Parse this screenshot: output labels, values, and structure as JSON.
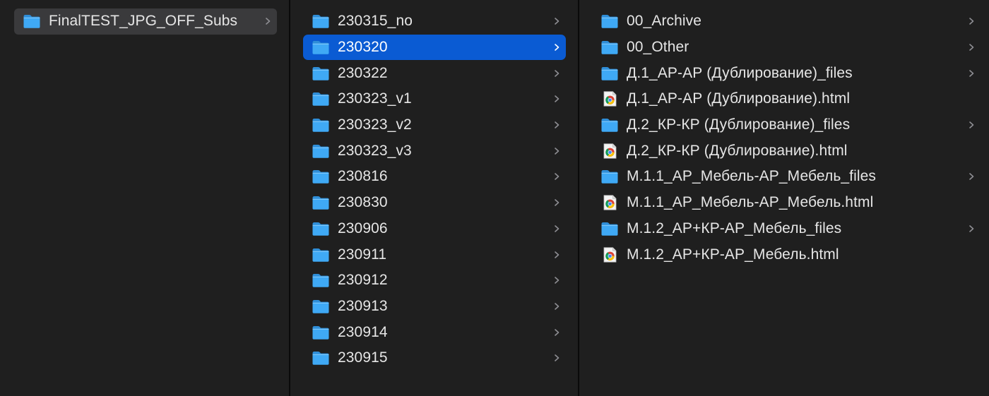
{
  "colors": {
    "background": "#1f1f1f",
    "divider": "#0a0a0a",
    "selected": "#0a5bd3",
    "parent_highlight": "#3a3a3c",
    "folder_blue": "#3fa9f5",
    "text": "#e6e6e6"
  },
  "columns": [
    {
      "items": [
        {
          "label": "FinalTEST_JPG_OFF_Subs",
          "kind": "folder",
          "state": "parent",
          "chevron": true
        }
      ]
    },
    {
      "items": [
        {
          "label": "230315_no",
          "kind": "folder",
          "state": "",
          "chevron": true
        },
        {
          "label": "230320",
          "kind": "folder",
          "state": "selected",
          "chevron": true
        },
        {
          "label": "230322",
          "kind": "folder",
          "state": "",
          "chevron": true
        },
        {
          "label": "230323_v1",
          "kind": "folder",
          "state": "",
          "chevron": true
        },
        {
          "label": "230323_v2",
          "kind": "folder",
          "state": "",
          "chevron": true
        },
        {
          "label": "230323_v3",
          "kind": "folder",
          "state": "",
          "chevron": true
        },
        {
          "label": "230816",
          "kind": "folder",
          "state": "",
          "chevron": true
        },
        {
          "label": "230830",
          "kind": "folder",
          "state": "",
          "chevron": true
        },
        {
          "label": "230906",
          "kind": "folder",
          "state": "",
          "chevron": true
        },
        {
          "label": "230911",
          "kind": "folder",
          "state": "",
          "chevron": true
        },
        {
          "label": "230912",
          "kind": "folder",
          "state": "",
          "chevron": true
        },
        {
          "label": "230913",
          "kind": "folder",
          "state": "",
          "chevron": true
        },
        {
          "label": "230914",
          "kind": "folder",
          "state": "",
          "chevron": true
        },
        {
          "label": "230915",
          "kind": "folder",
          "state": "",
          "chevron": true
        }
      ]
    },
    {
      "items": [
        {
          "label": "00_Archive",
          "kind": "folder",
          "state": "",
          "chevron": true
        },
        {
          "label": "00_Other",
          "kind": "folder",
          "state": "",
          "chevron": true
        },
        {
          "label": "Д.1_АР-АР (Дублирование)_files",
          "kind": "folder",
          "state": "",
          "chevron": true
        },
        {
          "label": "Д.1_АР-АР (Дублирование).html",
          "kind": "html",
          "state": "",
          "chevron": false
        },
        {
          "label": "Д.2_КР-КР (Дублирование)_files",
          "kind": "folder",
          "state": "",
          "chevron": true
        },
        {
          "label": "Д.2_КР-КР (Дублирование).html",
          "kind": "html",
          "state": "",
          "chevron": false
        },
        {
          "label": "М.1.1_АР_Мебель-АР_Мебель_files",
          "kind": "folder",
          "state": "",
          "chevron": true
        },
        {
          "label": "М.1.1_АР_Мебель-АР_Мебель.html",
          "kind": "html",
          "state": "",
          "chevron": false
        },
        {
          "label": "М.1.2_АР+КР-АР_Мебель_files",
          "kind": "folder",
          "state": "",
          "chevron": true
        },
        {
          "label": "М.1.2_АР+КР-АР_Мебель.html",
          "kind": "html",
          "state": "",
          "chevron": false
        }
      ]
    }
  ],
  "icons": {
    "folder": "folder-icon",
    "html": "chrome-html-file-icon",
    "chevron": "chevron-right-icon"
  }
}
